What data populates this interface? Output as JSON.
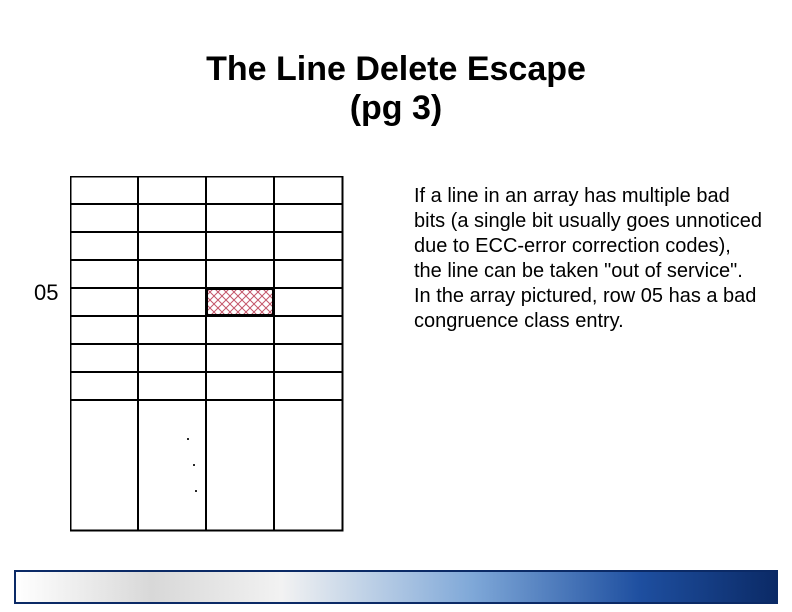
{
  "title_line1": "The Line Delete Escape",
  "title_line2": "(pg 3)",
  "row_label": "05",
  "body_p1": "If a line in an array has multiple bad bits (a single bit usually goes unnoticed due to ECC-error correction codes), the line can be taken \"out of service\".",
  "body_p2": "In the array pictured, row 05 has a bad congruence class entry.",
  "ellipsis1": ".",
  "ellipsis2": ".",
  "ellipsis3": "."
}
